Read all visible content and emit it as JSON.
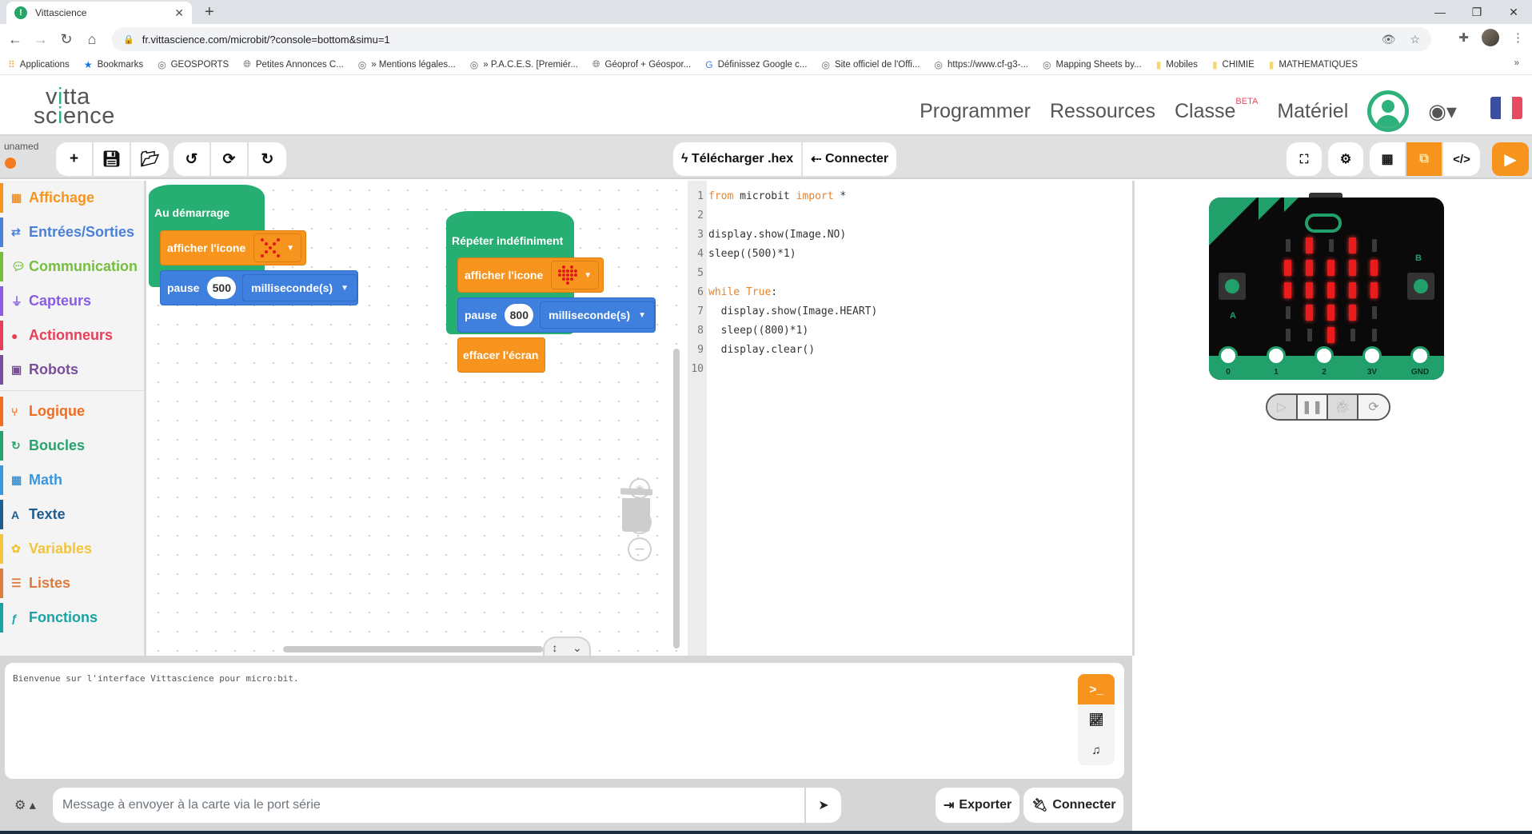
{
  "browser": {
    "tab_title": "Vittascience",
    "url": "fr.vittascience.com/microbit/?console=bottom&simu=1",
    "bookmarks": [
      {
        "label": "Applications",
        "icon": "apps-grid-icon"
      },
      {
        "label": "Bookmarks",
        "icon": "star-icon"
      },
      {
        "label": "GEOSPORTS",
        "icon": "site-icon"
      },
      {
        "label": "Petites Annonces C...",
        "icon": "globe-icon"
      },
      {
        "label": "» Mentions légales...",
        "icon": "site-icon"
      },
      {
        "label": "» P.A.C.E.S. [Premiér...",
        "icon": "site-icon"
      },
      {
        "label": "Géoprof + Géospor...",
        "icon": "globe-icon"
      },
      {
        "label": "Définissez Google c...",
        "icon": "google-icon"
      },
      {
        "label": "Site officiel de l'Offi...",
        "icon": "site-icon"
      },
      {
        "label": "https://www.cf-g3-...",
        "icon": "site-icon"
      },
      {
        "label": "Mapping Sheets by...",
        "icon": "site-icon"
      },
      {
        "label": "Mobiles",
        "icon": "folder-icon"
      },
      {
        "label": "CHIMIE",
        "icon": "folder-icon"
      },
      {
        "label": "MATHEMATIQUES",
        "icon": "folder-icon"
      }
    ]
  },
  "header": {
    "logo_line1": "vitta",
    "logo_line2": "science",
    "nav": [
      "Programmer",
      "Ressources",
      "Classe",
      "Matériel"
    ],
    "beta_badge": "BETA",
    "flag_colors": [
      "#3b4fa0",
      "#ffffff",
      "#e84a5f"
    ]
  },
  "toolbar": {
    "project_name": "unamed",
    "status_color": "#f47b20",
    "download_label": "Télécharger .hex",
    "connect_label": "Connecter"
  },
  "sidebar": {
    "categories": [
      {
        "label": "Affichage",
        "color": "#f7941d",
        "icon": "grid-icon"
      },
      {
        "label": "Entrées/Sorties",
        "color": "#4a80d9",
        "icon": "arrows-icon"
      },
      {
        "label": "Communication",
        "color": "#75bf3e",
        "icon": "chat-icon"
      },
      {
        "label": "Capteurs",
        "color": "#8a5ce6",
        "icon": "plug-icon"
      },
      {
        "label": "Actionneurs",
        "color": "#e83e5a",
        "icon": "bulb-icon"
      },
      {
        "label": "Robots",
        "color": "#7a4e9c",
        "icon": "robot-icon"
      },
      {
        "label": "Logique",
        "color": "#f26d21",
        "icon": "branch-icon"
      },
      {
        "label": "Boucles",
        "color": "#27a36d",
        "icon": "loop-icon"
      },
      {
        "label": "Math",
        "color": "#3a96dd",
        "icon": "calculator-icon"
      },
      {
        "label": "Texte",
        "color": "#1d5d90",
        "icon": "text-icon"
      },
      {
        "label": "Variables",
        "color": "#f2c53d",
        "icon": "gear-icon"
      },
      {
        "label": "Listes",
        "color": "#dc7c3f",
        "icon": "list-icon"
      },
      {
        "label": "Fonctions",
        "color": "#1aa3a3",
        "icon": "function-icon"
      }
    ]
  },
  "blocks": {
    "start": {
      "title": "Au démarrage",
      "show_icon": "afficher l'icone",
      "pause": "pause",
      "pause_value": "500",
      "unit": "milliseconde(s)"
    },
    "loop": {
      "title": "Répéter indéfiniment",
      "show_icon": "afficher l'icone",
      "pause": "pause",
      "pause_value": "800",
      "unit": "milliseconde(s)",
      "clear": "effacer l'écran"
    }
  },
  "code": {
    "lines": [
      {
        "n": "1",
        "text": "from microbit import *"
      },
      {
        "n": "2",
        "text": ""
      },
      {
        "n": "3",
        "text": "display.show(Image.NO)"
      },
      {
        "n": "4",
        "text": "sleep((500)*1)"
      },
      {
        "n": "5",
        "text": ""
      },
      {
        "n": "6",
        "text": "while True:"
      },
      {
        "n": "7",
        "text": "  display.show(Image.HEART)"
      },
      {
        "n": "8",
        "text": "  sleep((800)*1)"
      },
      {
        "n": "9",
        "text": "  display.clear()"
      },
      {
        "n": "10",
        "text": ""
      }
    ]
  },
  "simulator": {
    "pins": [
      "0",
      "1",
      "2",
      "3V",
      "GND"
    ],
    "button_a": "A",
    "button_b": "B",
    "led_matrix": [
      [
        0,
        1,
        0,
        1,
        0
      ],
      [
        1,
        1,
        1,
        1,
        1
      ],
      [
        1,
        1,
        1,
        1,
        1
      ],
      [
        0,
        1,
        1,
        1,
        0
      ],
      [
        0,
        0,
        1,
        0,
        0
      ]
    ]
  },
  "console": {
    "welcome": "Bienvenue sur l'interface Vittascience pour micro:bit.",
    "input_placeholder": "Message à envoyer à la carte via le port série",
    "export_label": "Exporter",
    "connect_label": "Connecter"
  }
}
